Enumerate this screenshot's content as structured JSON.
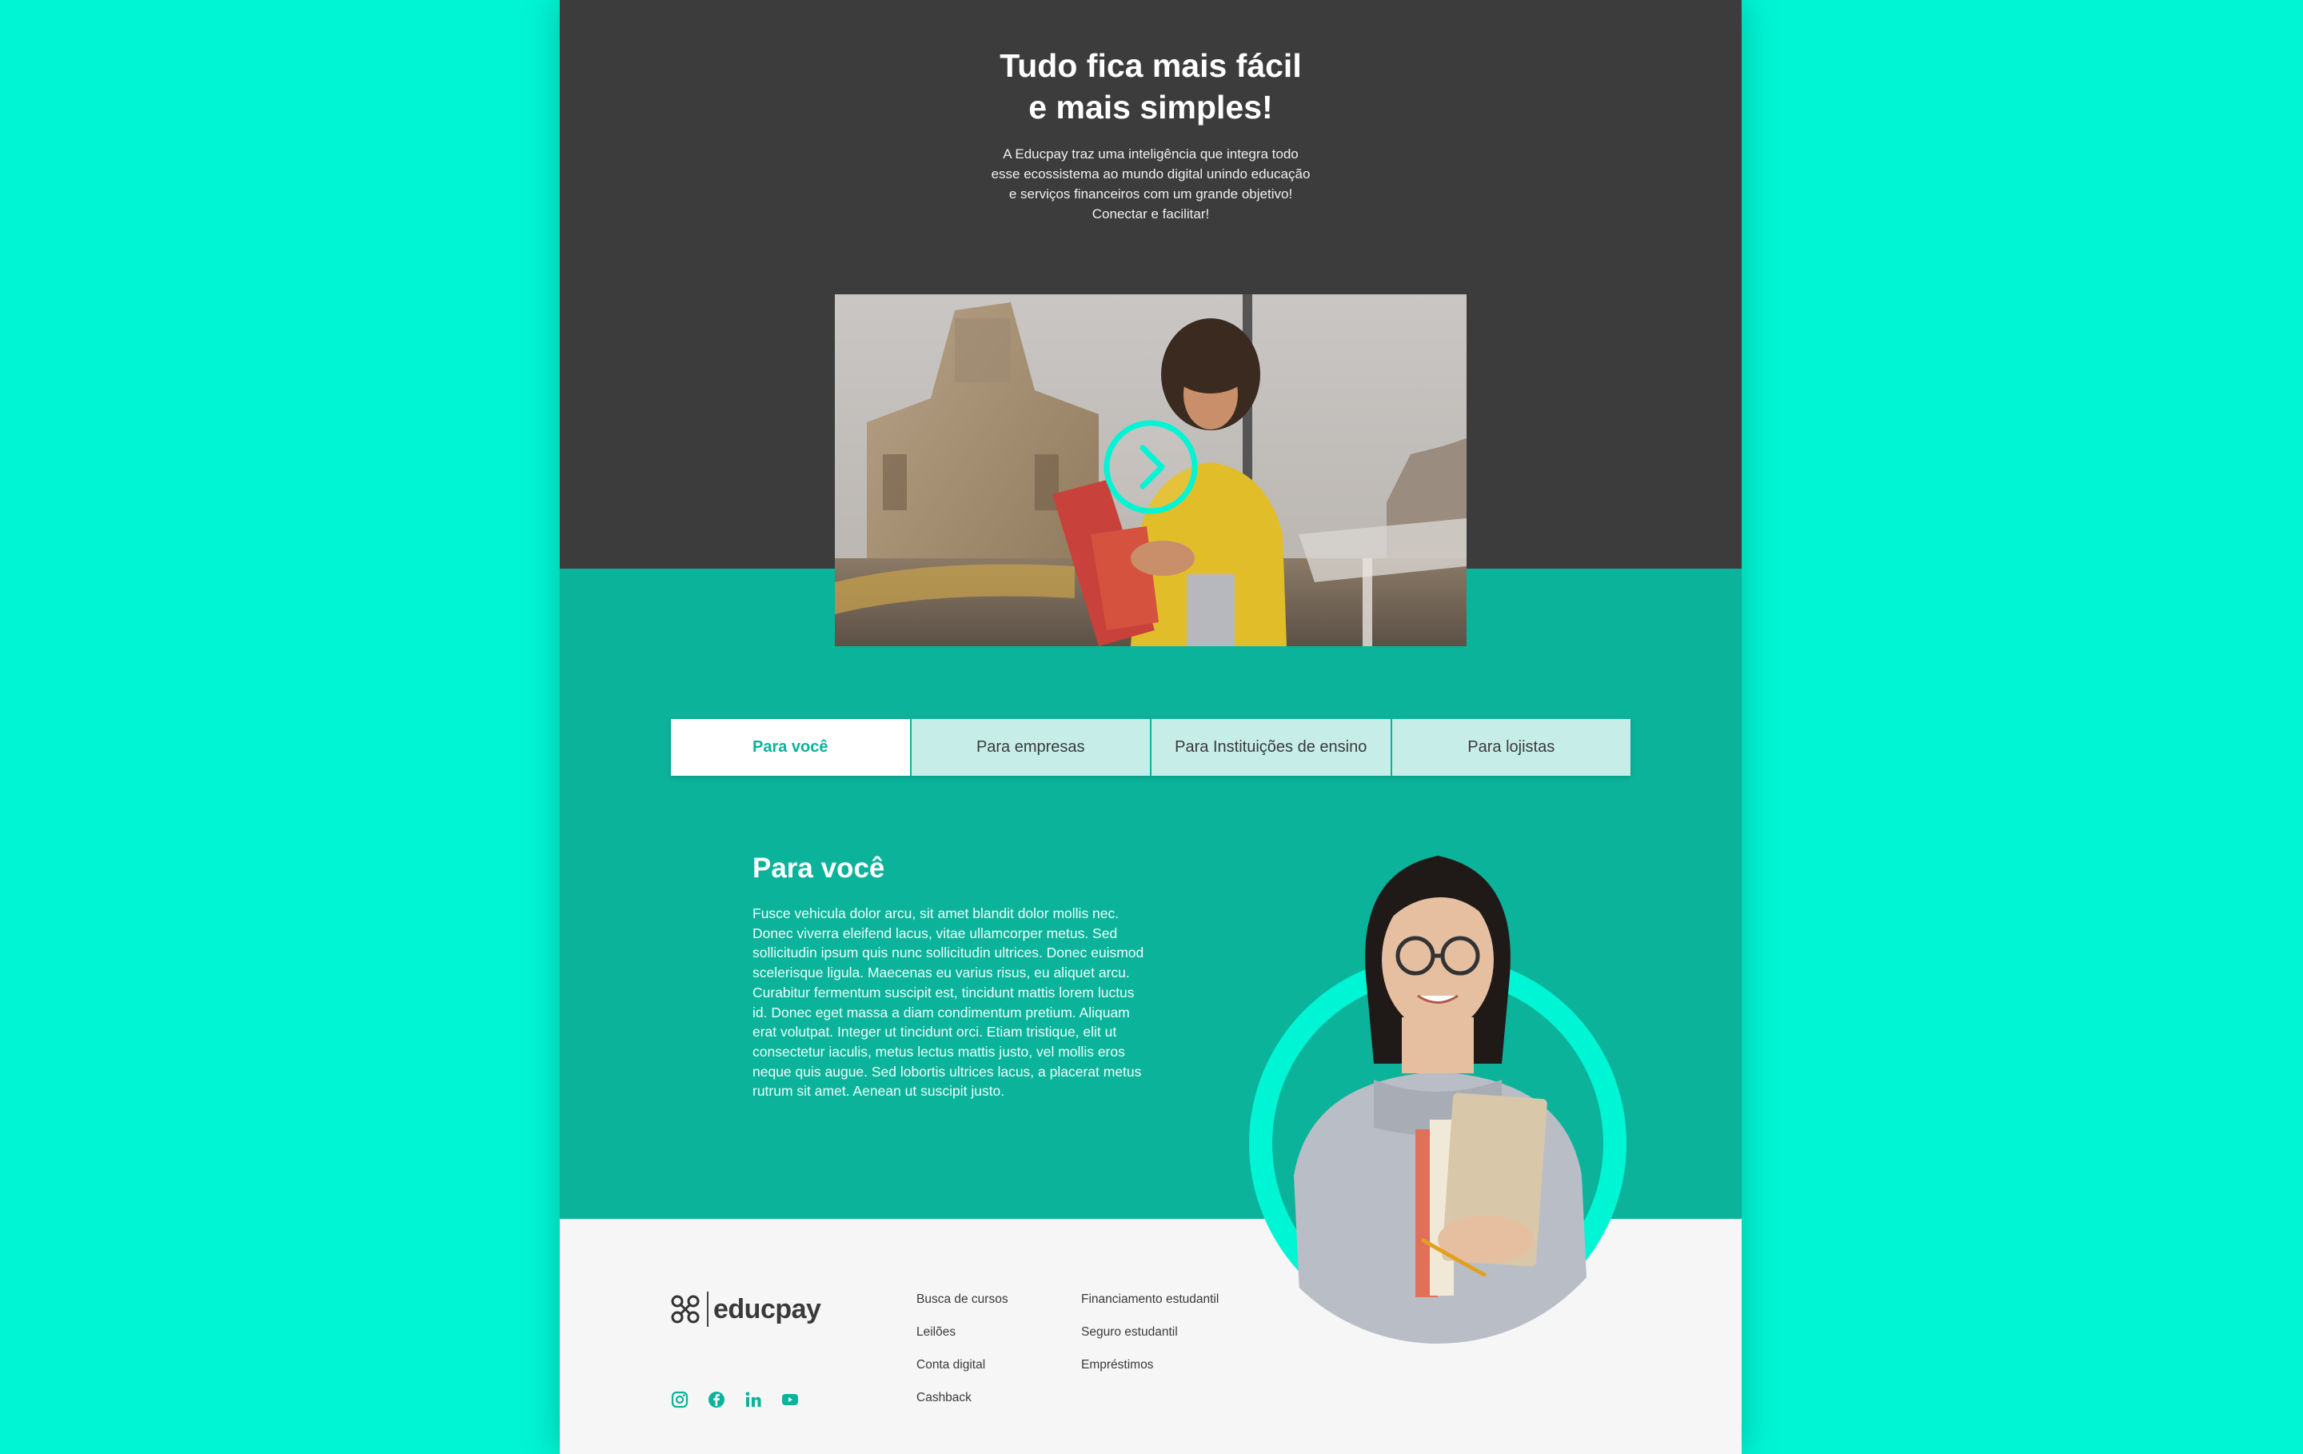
{
  "colors": {
    "accent": "#0bb39b",
    "bright": "#00f5d4",
    "dark": "#3c3c3c",
    "footer_bg": "#f6f6f6"
  },
  "hero": {
    "title": "Tudo fica mais fácil e mais simples!",
    "description": "A Educpay traz uma inteligência que integra todo esse ecossistema ao mundo digital unindo educação e serviços financeiros com um grande objetivo! Conectar e facilitar!"
  },
  "video": {
    "play_icon": "play-icon"
  },
  "tabs": [
    {
      "label": "Para você",
      "active": true
    },
    {
      "label": "Para empresas",
      "active": false
    },
    {
      "label": "Para Instituições de ensino",
      "active": false
    },
    {
      "label": "Para lojistas",
      "active": false
    }
  ],
  "section": {
    "title": "Para você",
    "text": "Fusce vehicula dolor arcu, sit amet blandit dolor mollis nec. Donec viverra eleifend lacus, vitae ullamcorper metus. Sed sollicitudin ipsum quis nunc sollicitudin ultrices. Donec euismod scelerisque ligula. Maecenas eu varius risus, eu aliquet arcu. Curabitur fermentum suscipit est, tincidunt mattis lorem luctus id. Donec eget massa a diam condimentum pretium. Aliquam erat volutpat. Integer ut tincidunt orci. Etiam tristique, elit ut consectetur iaculis, metus lectus mattis justo, vel mollis eros neque quis augue. Sed lobortis ultrices lacus, a placerat metus rutrum sit amet. Aenean ut suscipit justo."
  },
  "footer": {
    "logo_text": "educpay",
    "links_col1": [
      "Busca de cursos",
      "Leilões",
      "Conta digital",
      "Cashback"
    ],
    "links_col2": [
      "Financiamento estudantil",
      "Seguro estudantil",
      "Empréstimos"
    ],
    "social": [
      "instagram-icon",
      "facebook-icon",
      "linkedin-icon",
      "youtube-icon"
    ]
  }
}
